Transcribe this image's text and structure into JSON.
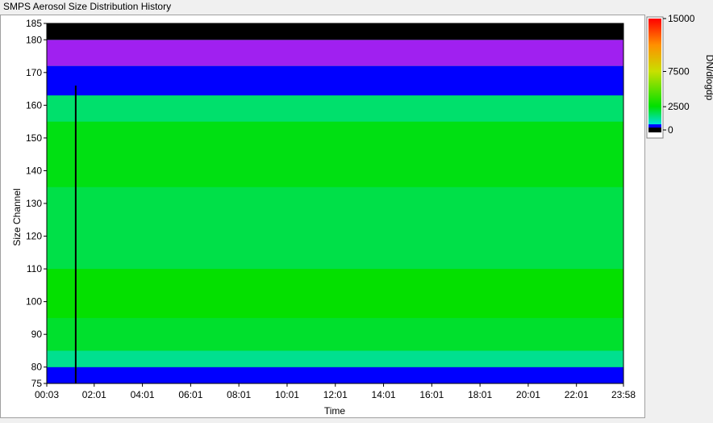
{
  "window_title": "SMPS Aerosol Size Distribution History",
  "chart_data": {
    "type": "heatmap",
    "title": "SMPS Aerosol Size Distribution History",
    "xlabel": "Time",
    "ylabel": "Size Channel",
    "x_ticks": [
      "00:03",
      "02:01",
      "04:01",
      "06:01",
      "08:01",
      "10:01",
      "12:01",
      "14:01",
      "16:01",
      "18:01",
      "20:01",
      "22:01",
      "23:58"
    ],
    "x_range": [
      "00:03",
      "23:58"
    ],
    "y_ticks": [
      75,
      80,
      90,
      100,
      110,
      120,
      130,
      140,
      150,
      160,
      170,
      180,
      185
    ],
    "ylim": [
      75,
      185
    ],
    "colorbar": {
      "label": "DN/dlogdp",
      "ticks": [
        0,
        2500,
        7500,
        15000
      ],
      "range": [
        0,
        15000
      ]
    },
    "cursor_time": "01:15",
    "colors": {
      "zero": "#000000",
      "low": "#0000ff",
      "mid_low": "#00e0e0",
      "mid": "#00e000",
      "mid_high": "#e0e000",
      "high": "#ff0000",
      "above_range": "#a020f0"
    },
    "bands": [
      {
        "size_range": [
          75,
          80
        ],
        "dN_dlogdp": 300
      },
      {
        "size_range": [
          80,
          85
        ],
        "dN_dlogdp": 900
      },
      {
        "size_range": [
          85,
          95
        ],
        "dN_dlogdp": 2000
      },
      {
        "size_range": [
          95,
          110
        ],
        "dN_dlogdp": 2600
      },
      {
        "size_range": [
          110,
          135
        ],
        "dN_dlogdp": 1700
      },
      {
        "size_range": [
          135,
          155
        ],
        "dN_dlogdp": 2300
      },
      {
        "size_range": [
          155,
          163
        ],
        "dN_dlogdp": 1300
      },
      {
        "size_range": [
          163,
          172
        ],
        "dN_dlogdp": 500
      },
      {
        "size_range": [
          172,
          180
        ],
        "dN_dlogdp": 150
      },
      {
        "size_range": [
          180,
          185
        ],
        "dN_dlogdp": 0
      }
    ]
  }
}
